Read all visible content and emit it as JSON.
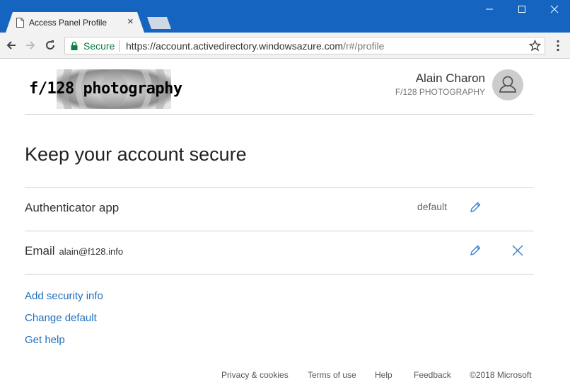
{
  "browser": {
    "tab_title": "Access Panel Profile",
    "secure_label": "Secure",
    "url_main": "https://account.activedirectory.windowsazure.com",
    "url_rest": "/r#/profile"
  },
  "header": {
    "logo_text": "f/128 photography",
    "user_name": "Alain Charon",
    "org_name": "F/128 PHOTOGRAPHY"
  },
  "main": {
    "title": "Keep your account secure",
    "methods": [
      {
        "label": "Authenticator app",
        "detail": "",
        "badge": "default"
      },
      {
        "label": "Email",
        "detail": "alain@f128.info",
        "badge": ""
      }
    ],
    "links": [
      "Add security info",
      "Change default",
      "Get help"
    ]
  },
  "footer": {
    "privacy": "Privacy & cookies",
    "terms": "Terms of use",
    "help": "Help",
    "feedback": "Feedback",
    "copyright": "©2018 Microsoft"
  },
  "colors": {
    "titlebar": "#1565c0",
    "link": "#1e6fbf",
    "secure": "#0b8043"
  }
}
